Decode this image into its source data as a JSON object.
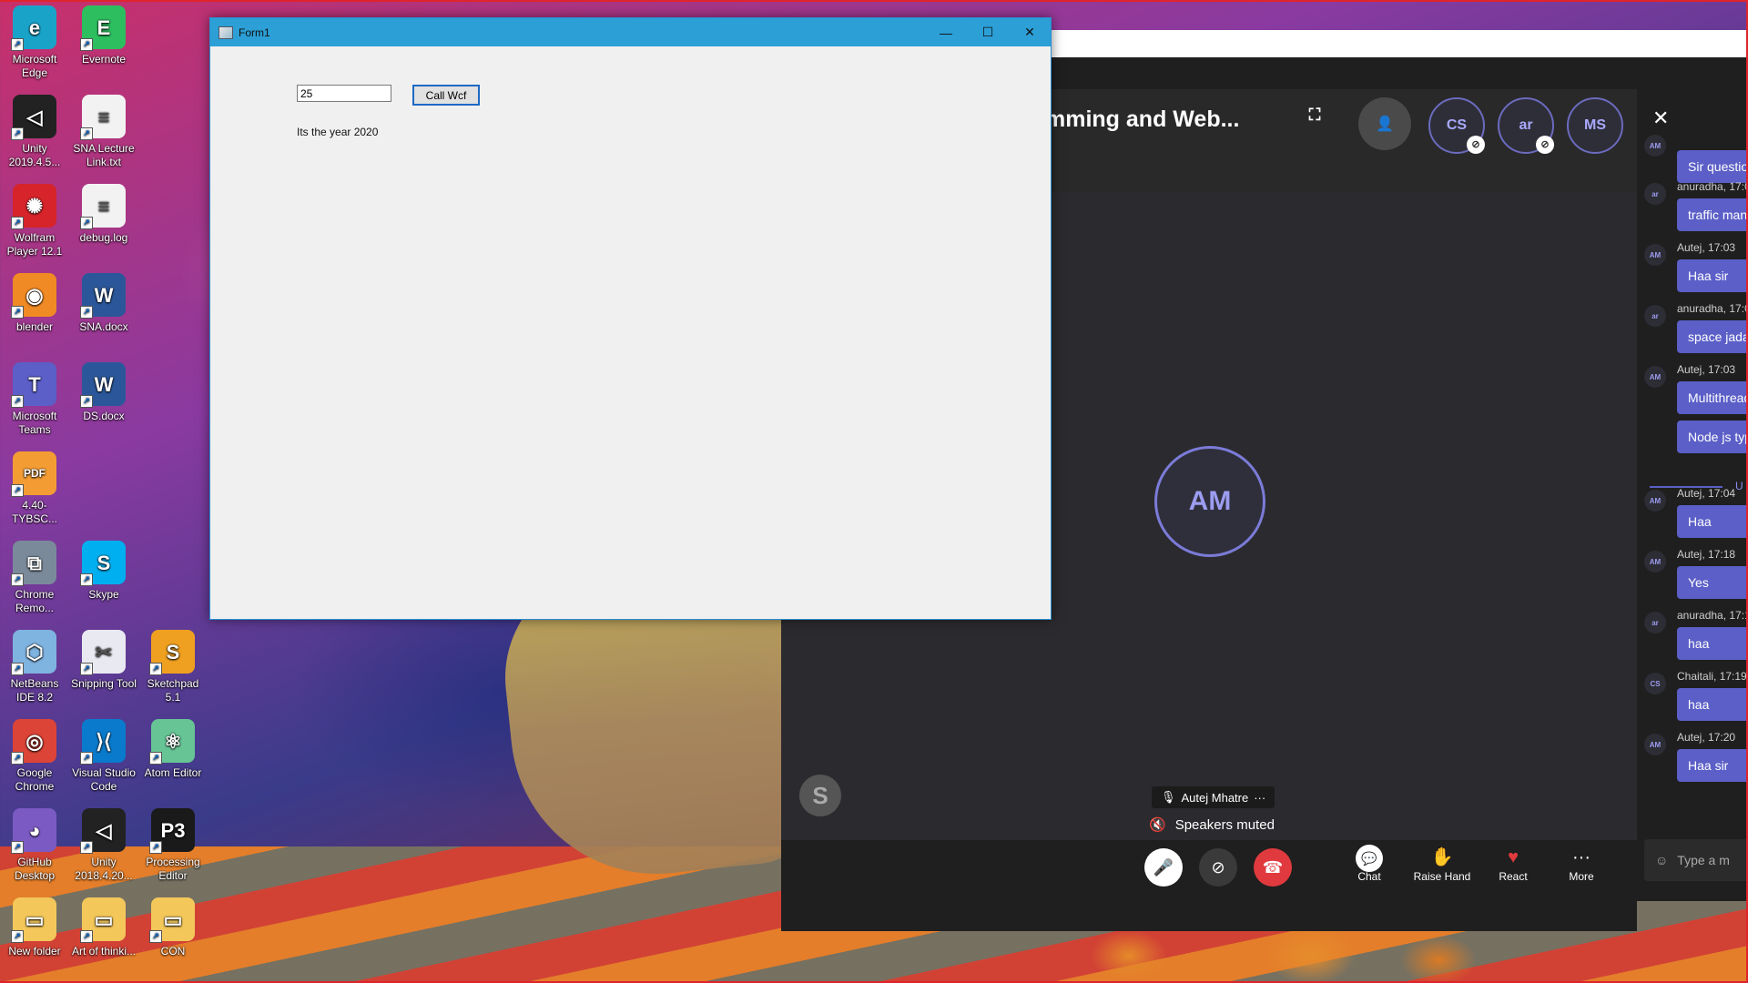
{
  "desktop": {
    "icons": [
      {
        "label": "Microsoft Edge",
        "icon": "edge-icon",
        "color": "#1aa3c9",
        "glyph": "e"
      },
      {
        "label": "Evernote",
        "icon": "evernote-icon",
        "color": "#2dbe60",
        "glyph": "E"
      },
      {
        "label": "Unity 2019.4.5...",
        "icon": "unity-icon",
        "color": "#222222",
        "glyph": "◁"
      },
      {
        "label": "SNA Lecture Link.txt",
        "icon": "text-file-icon",
        "color": "#f2f2f2",
        "glyph": "≡"
      },
      {
        "label": "Wolfram Player 12.1",
        "icon": "wolfram-icon",
        "color": "#d6242a",
        "glyph": "✺"
      },
      {
        "label": "debug.log",
        "icon": "text-file-icon",
        "color": "#f2f2f2",
        "glyph": "≡"
      },
      {
        "label": "blender",
        "icon": "blender-icon",
        "color": "#f08a24",
        "glyph": "◉"
      },
      {
        "label": "SNA.docx",
        "icon": "word-icon",
        "color": "#2b579a",
        "glyph": "W"
      },
      {
        "label": "Microsoft Teams",
        "icon": "teams-icon",
        "color": "#5b5fc7",
        "glyph": "T"
      },
      {
        "label": "DS.docx",
        "icon": "word-icon",
        "color": "#2b579a",
        "glyph": "W"
      },
      {
        "label": "4.40-TYBSC...",
        "icon": "pdf-icon",
        "color": "#f39c33",
        "glyph": "PDF"
      },
      {
        "label": "Chrome Remo...",
        "icon": "chrome-remote-icon",
        "color": "#7a8a9a",
        "glyph": "⧉"
      },
      {
        "label": "Skype",
        "icon": "skype-icon",
        "color": "#00aff0",
        "glyph": "S"
      },
      {
        "label": "NetBeans IDE 8.2",
        "icon": "netbeans-icon",
        "color": "#7fb3e0",
        "glyph": "⬡"
      },
      {
        "label": "Snipping Tool",
        "icon": "snipping-tool-icon",
        "color": "#e9e9f2",
        "glyph": "✂"
      },
      {
        "label": "Sketchpad 5.1",
        "icon": "sketchpad-icon",
        "color": "#f0a020",
        "glyph": "S"
      },
      {
        "label": "Google Chrome",
        "icon": "chrome-icon",
        "color": "#db4437",
        "glyph": "◎"
      },
      {
        "label": "Visual Studio Code",
        "icon": "vscode-icon",
        "color": "#0a7acc",
        "glyph": "⟩⟨"
      },
      {
        "label": "Atom Editor",
        "icon": "atom-icon",
        "color": "#66c495",
        "glyph": "⚛"
      },
      {
        "label": "GitHub Desktop",
        "icon": "github-icon",
        "color": "#7b5ac4",
        "glyph": "◕"
      },
      {
        "label": "Unity 2018.4.20...",
        "icon": "unity-icon",
        "color": "#222222",
        "glyph": "◁"
      },
      {
        "label": "Processing Editor",
        "icon": "processing-icon",
        "color": "#1a1a1a",
        "glyph": "P3"
      },
      {
        "label": "New folder",
        "icon": "folder-icon",
        "color": "#f3c75a",
        "glyph": "▭"
      },
      {
        "label": "Art of thinki...",
        "icon": "folder-icon",
        "color": "#f3c75a",
        "glyph": "▭"
      },
      {
        "label": "CON",
        "icon": "folder-icon",
        "color": "#f3c75a",
        "glyph": "▭"
      }
    ]
  },
  "form1": {
    "title": "Form1",
    "textbox_value": "25",
    "button_label": "Call Wcf",
    "output_label": "Its the year 2020",
    "minimize": "—",
    "maximize": "☐",
    "close": "✕"
  },
  "teams": {
    "meeting_title": "mming and Web...",
    "participants": [
      {
        "initials": "CS",
        "muted": true
      },
      {
        "initials": "ar",
        "muted": true
      },
      {
        "initials": "MS",
        "muted": false
      }
    ],
    "main_avatar": "AM",
    "skype_badge": "S",
    "speaker_name": "Autej Mhatre",
    "speaker_more": "···",
    "speakers_status": "Speakers muted",
    "controls": {
      "chat": "Chat",
      "raise_hand": "Raise Hand",
      "react": "React",
      "more": "More"
    },
    "chat_messages": [
      {
        "avatar": "AM",
        "meta": "",
        "text": "Sir questio"
      },
      {
        "avatar": "ar",
        "meta": "anuradha, 17:0",
        "text": "traffic man"
      },
      {
        "avatar": "AM",
        "meta": "Autej, 17:03",
        "text": "Haa sir"
      },
      {
        "avatar": "ar",
        "meta": "anuradha, 17:0",
        "text": "space jada"
      },
      {
        "avatar": "AM",
        "meta": "Autej, 17:03",
        "text": "Multithread"
      },
      {
        "avatar": "",
        "meta": "",
        "text": "Node js typ"
      },
      {
        "avatar": "AM",
        "meta": "Autej, 17:04",
        "text": "Haa"
      },
      {
        "avatar": "AM",
        "meta": "Autej, 17:18",
        "text": "Yes"
      },
      {
        "avatar": "ar",
        "meta": "anuradha, 17:1",
        "text": "haa"
      },
      {
        "avatar": "CS",
        "meta": "Chaitali, 17:19",
        "text": "haa"
      },
      {
        "avatar": "AM",
        "meta": "Autej, 17:20",
        "text": "Haa sir"
      }
    ],
    "divider_label": "U",
    "compose_placeholder": "Type a m"
  },
  "colors": {
    "teams_purple": "#5b5fc7",
    "win_title_blue": "#2b9fd6",
    "hangup_red": "#e03a3e"
  }
}
